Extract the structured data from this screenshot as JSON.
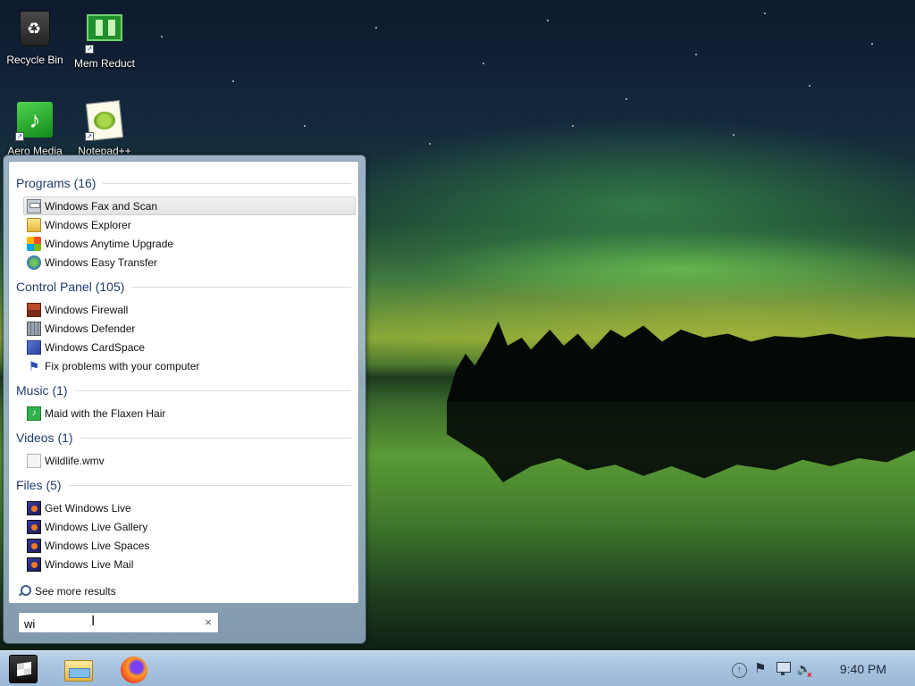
{
  "desktop": {
    "icons": [
      {
        "label": "Recycle Bin",
        "icon": "recycle-bin-icon"
      },
      {
        "label": "Mem Reduct",
        "icon": "mem-reduct-icon"
      },
      {
        "label": "Aero Media",
        "icon": "music-note-icon"
      },
      {
        "label": "Notepad++",
        "icon": "notepad-plus-plus-icon"
      }
    ]
  },
  "start_menu": {
    "groups": [
      {
        "header": "Programs (16)",
        "items": [
          {
            "label": "Windows Fax and Scan",
            "icon": "fax-icon",
            "selected": true
          },
          {
            "label": "Windows Explorer",
            "icon": "folder-icon"
          },
          {
            "label": "Windows Anytime Upgrade",
            "icon": "windows-logo-icon"
          },
          {
            "label": "Windows Easy Transfer",
            "icon": "easy-transfer-icon"
          }
        ]
      },
      {
        "header": "Control Panel (105)",
        "items": [
          {
            "label": "Windows Firewall",
            "icon": "firewall-icon"
          },
          {
            "label": "Windows Defender",
            "icon": "defender-icon"
          },
          {
            "label": "Windows CardSpace",
            "icon": "cardspace-icon"
          },
          {
            "label": "Fix problems with your computer",
            "icon": "flag-icon"
          }
        ]
      },
      {
        "header": "Music (1)",
        "items": [
          {
            "label": "Maid with the Flaxen Hair",
            "icon": "music-file-icon"
          }
        ]
      },
      {
        "header": "Videos (1)",
        "items": [
          {
            "label": "Wildlife.wmv",
            "icon": "video-file-icon"
          }
        ]
      },
      {
        "header": "Files (5)",
        "items": [
          {
            "label": "Get Windows Live",
            "icon": "windows-live-icon"
          },
          {
            "label": "Windows Live Gallery",
            "icon": "windows-live-icon"
          },
          {
            "label": "Windows Live Spaces",
            "icon": "windows-live-icon"
          },
          {
            "label": "Windows Live Mail",
            "icon": "windows-live-icon"
          }
        ]
      }
    ],
    "see_more": "See more results",
    "search": {
      "value": "wi",
      "clear_glyph": "×"
    }
  },
  "taskbar": {
    "pinned": [
      {
        "name": "Windows Explorer",
        "icon": "folder-icon"
      },
      {
        "name": "Firefox",
        "icon": "firefox-icon"
      }
    ],
    "tray": {
      "icons": [
        "show-hidden-icons-icon",
        "action-center-flag-icon",
        "network-icon",
        "volume-muted-icon"
      ],
      "clock": "9:40 PM"
    }
  }
}
